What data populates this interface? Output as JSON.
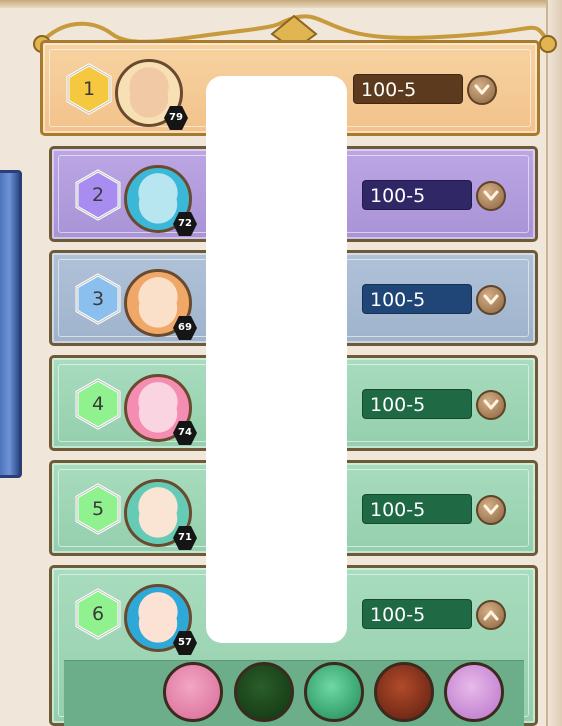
{
  "rows": [
    {
      "rank": "1",
      "level": "79",
      "code": "100-5",
      "theme": "gold",
      "expanded": false,
      "portrait": "blonde-character"
    },
    {
      "rank": "2",
      "level": "72",
      "code": "100-5",
      "theme": "purple",
      "expanded": false,
      "portrait": "teal-hair-character"
    },
    {
      "rank": "3",
      "level": "69",
      "code": "100-5",
      "theme": "blue",
      "expanded": false,
      "portrait": "orange-hair-character"
    },
    {
      "rank": "4",
      "level": "74",
      "code": "100-5",
      "theme": "green",
      "expanded": false,
      "portrait": "pink-hair-character"
    },
    {
      "rank": "5",
      "level": "71",
      "code": "100-5",
      "theme": "green",
      "expanded": false,
      "portrait": "cat-ear-character"
    },
    {
      "rank": "6",
      "level": "57",
      "code": "100-5",
      "theme": "green",
      "expanded": true,
      "portrait": "blue-hair-character"
    }
  ],
  "skills": [
    "pink-hair-skill-icon",
    "meditation-skill-icon",
    "heal-ring-skill-icon",
    "barrel-skill-icon",
    "ghost-skill-icon"
  ],
  "colors": {
    "gold": "#f2c28b",
    "purple": "#a893d6",
    "blue": "#9fb3cc",
    "green": "#94cfad",
    "hex_gold": "#f6c83f",
    "hex_purple": "#a98cf0",
    "hex_blue": "#8bc0ee",
    "hex_green": "#8ff28f"
  }
}
